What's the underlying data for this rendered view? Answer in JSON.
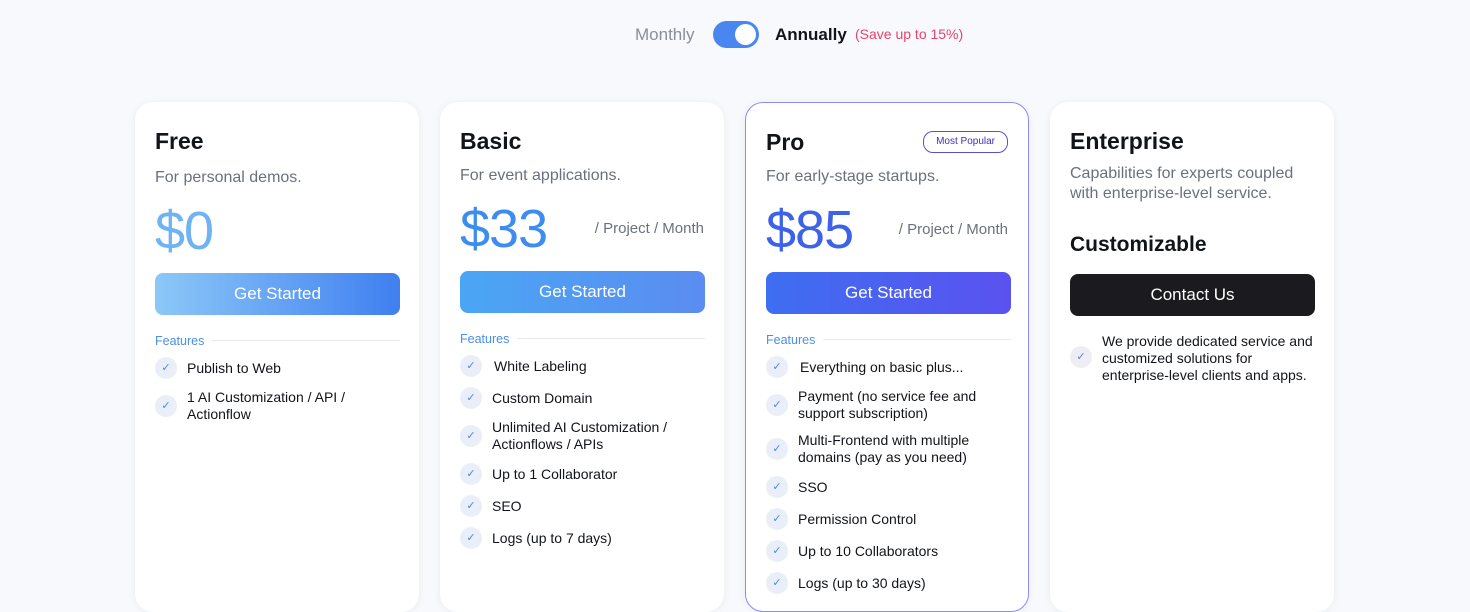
{
  "billing": {
    "monthly_label": "Monthly",
    "annually_label": "Annually",
    "save_note": "(Save up to 15%)",
    "annual_selected": true
  },
  "colors": {
    "accent_blue": "#4a86f0",
    "save_pink": "#e5446b",
    "pro_border": "#8f8cf0",
    "dark_button": "#1b1b1f"
  },
  "plans": [
    {
      "name": "Free",
      "description": "For personal demos.",
      "price": "$0",
      "price_color": "#6fb3f2",
      "unit": "",
      "button_label": "Get Started",
      "features_label": "Features",
      "features": [
        "Publish to Web",
        "1 AI Customization / API / Actionflow"
      ]
    },
    {
      "name": "Basic",
      "description": "For event applications.",
      "price": "$33",
      "price_color": "#3d8cf0",
      "unit": "/ Project / Month",
      "button_label": "Get Started",
      "features_label": "Features",
      "features": [
        "White Labeling",
        "Custom Domain",
        "Unlimited AI Customization / Actionflows / APIs",
        "Up to 1 Collaborator",
        "SEO",
        "Logs (up to 7 days)"
      ]
    },
    {
      "name": "Pro",
      "badge": "Most Popular",
      "description": "For early-stage startups.",
      "price": "$85",
      "price_color": "#3d62e8",
      "unit": "/ Project / Month",
      "button_label": "Get Started",
      "features_label": "Features",
      "features": [
        "Everything on basic plus...",
        "Payment (no service fee and support subscription)",
        "Multi-Frontend with multiple domains (pay as you need)",
        "SSO",
        "Permission Control",
        "Up to 10 Collaborators",
        "Logs (up to 30 days)"
      ]
    },
    {
      "name": "Enterprise",
      "description": "Capabilities for experts coupled with enterprise-level service.",
      "price": "Customizable",
      "button_label": "Contact Us",
      "features": [
        "We provide dedicated service and customized solutions for enterprise-level clients and apps."
      ]
    }
  ]
}
